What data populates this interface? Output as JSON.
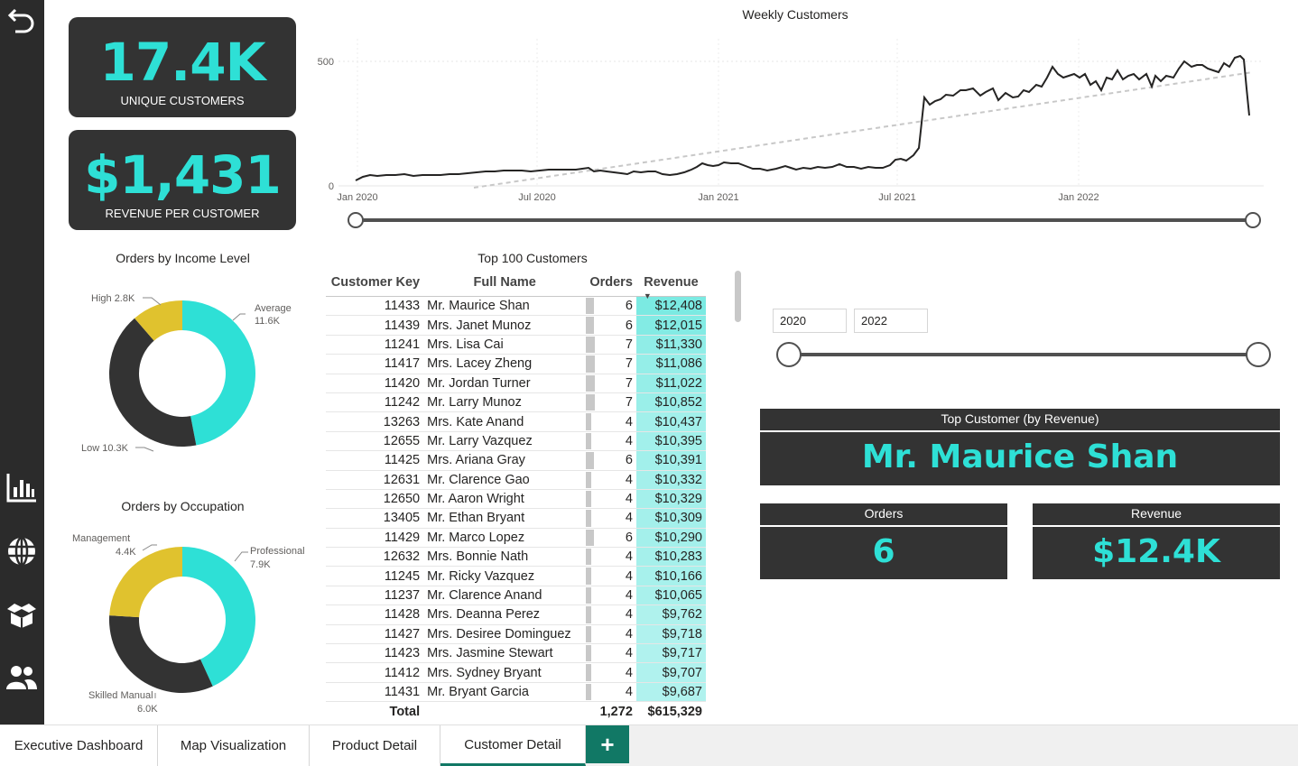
{
  "colors": {
    "accent": "#2ee0d6",
    "dark": "#333333",
    "yellow": "#e0c22e",
    "tab_green": "#117865"
  },
  "kpis": {
    "unique_customers": {
      "value": "17.4K",
      "label": "UNIQUE CUSTOMERS"
    },
    "revenue_per_customer": {
      "value": "$1,431",
      "label": "REVENUE PER CUSTOMER"
    }
  },
  "weekly_chart": {
    "title": "Weekly Customers",
    "y_ticks": [
      "500",
      "0"
    ],
    "x_ticks": [
      "Jan 2020",
      "Jul 2020",
      "Jan 2021",
      "Jul 2021",
      "Jan 2022"
    ]
  },
  "income_chart": {
    "title": "Orders by Income Level",
    "slices": [
      {
        "name": "Average",
        "value": "11.6K"
      },
      {
        "name": "Low",
        "value": "10.3K"
      },
      {
        "name": "High",
        "value": "2.8K"
      }
    ]
  },
  "occupation_chart": {
    "title": "Orders by Occupation",
    "slices": [
      {
        "name": "Professional",
        "value": "7.9K"
      },
      {
        "name": "Skilled Manual",
        "value": "6.0K"
      },
      {
        "name": "Management",
        "value": "4.4K"
      }
    ]
  },
  "table": {
    "title": "Top 100 Customers",
    "headers": [
      "Customer Key",
      "Full Name",
      "Orders",
      "Revenue"
    ],
    "rows": [
      [
        "11433",
        "Mr. Maurice Shan",
        "6",
        "$12,408"
      ],
      [
        "11439",
        "Mrs. Janet Munoz",
        "6",
        "$12,015"
      ],
      [
        "11241",
        "Mrs. Lisa Cai",
        "7",
        "$11,330"
      ],
      [
        "11417",
        "Mrs. Lacey Zheng",
        "7",
        "$11,086"
      ],
      [
        "11420",
        "Mr. Jordan Turner",
        "7",
        "$11,022"
      ],
      [
        "11242",
        "Mr. Larry Munoz",
        "7",
        "$10,852"
      ],
      [
        "13263",
        "Mrs. Kate Anand",
        "4",
        "$10,437"
      ],
      [
        "12655",
        "Mr. Larry Vazquez",
        "4",
        "$10,395"
      ],
      [
        "11425",
        "Mrs. Ariana Gray",
        "6",
        "$10,391"
      ],
      [
        "12631",
        "Mr. Clarence Gao",
        "4",
        "$10,332"
      ],
      [
        "12650",
        "Mr. Aaron Wright",
        "4",
        "$10,329"
      ],
      [
        "13405",
        "Mr. Ethan Bryant",
        "4",
        "$10,309"
      ],
      [
        "11429",
        "Mr. Marco Lopez",
        "6",
        "$10,290"
      ],
      [
        "12632",
        "Mrs. Bonnie Nath",
        "4",
        "$10,283"
      ],
      [
        "11245",
        "Mr. Ricky Vazquez",
        "4",
        "$10,166"
      ],
      [
        "11237",
        "Mr. Clarence Anand",
        "4",
        "$10,065"
      ],
      [
        "11428",
        "Mrs. Deanna Perez",
        "4",
        "$9,762"
      ],
      [
        "11427",
        "Mrs. Desiree Dominguez",
        "4",
        "$9,718"
      ],
      [
        "11423",
        "Mrs. Jasmine Stewart",
        "4",
        "$9,717"
      ],
      [
        "11412",
        "Mrs. Sydney Bryant",
        "4",
        "$9,707"
      ],
      [
        "11431",
        "Mr. Bryant Garcia",
        "4",
        "$9,687"
      ]
    ],
    "total": {
      "label": "Total",
      "orders": "1,272",
      "revenue": "$615,329"
    }
  },
  "year_slicer": {
    "start": "2020",
    "end": "2022"
  },
  "top_customer": {
    "title": "Top Customer (by Revenue)",
    "name": "Mr. Maurice Shan",
    "orders_label": "Orders",
    "orders_value": "6",
    "revenue_label": "Revenue",
    "revenue_value": "$12.4K"
  },
  "tabs": [
    "Executive Dashboard",
    "Map Visualization",
    "Product Detail",
    "Customer Detail"
  ],
  "tab_add": "+",
  "sidebar_icons": [
    "back-arrow-icon",
    "bar-chart-icon",
    "globe-icon",
    "box-icon",
    "people-icon"
  ]
}
